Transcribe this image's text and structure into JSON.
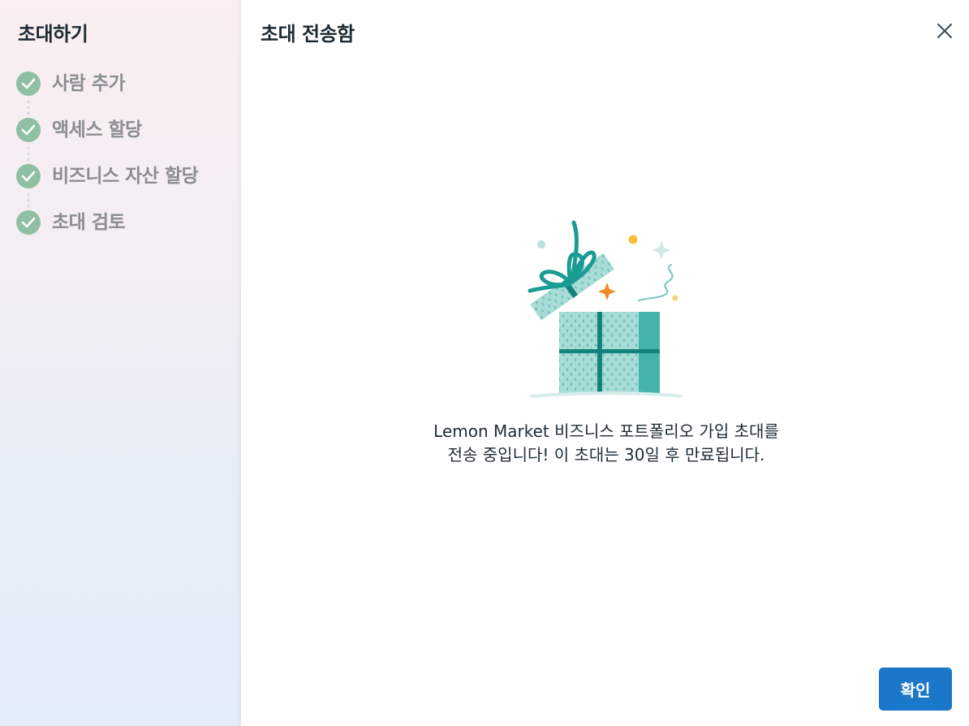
{
  "sidebar": {
    "title": "초대하기",
    "steps": [
      {
        "label": "사람 추가",
        "status": "complete"
      },
      {
        "label": "액세스 할당",
        "status": "complete"
      },
      {
        "label": "비즈니스 자산 할당",
        "status": "complete"
      },
      {
        "label": "초대 검토",
        "status": "complete"
      }
    ]
  },
  "content": {
    "title": "초대 전송함",
    "message_brand": "Lemon Market",
    "message_rest": " 비즈니스 포트폴리오 가입 초대를 전송 중입니다! 이 초대는 30일 후 만료됩니다.",
    "confirm_label": "확인",
    "close_icon": "close-icon",
    "illustration_icon": "gift-box-icon"
  },
  "colors": {
    "accent": "#1a77c9",
    "check": "#8fc0a4",
    "gift": "#22a69c"
  }
}
